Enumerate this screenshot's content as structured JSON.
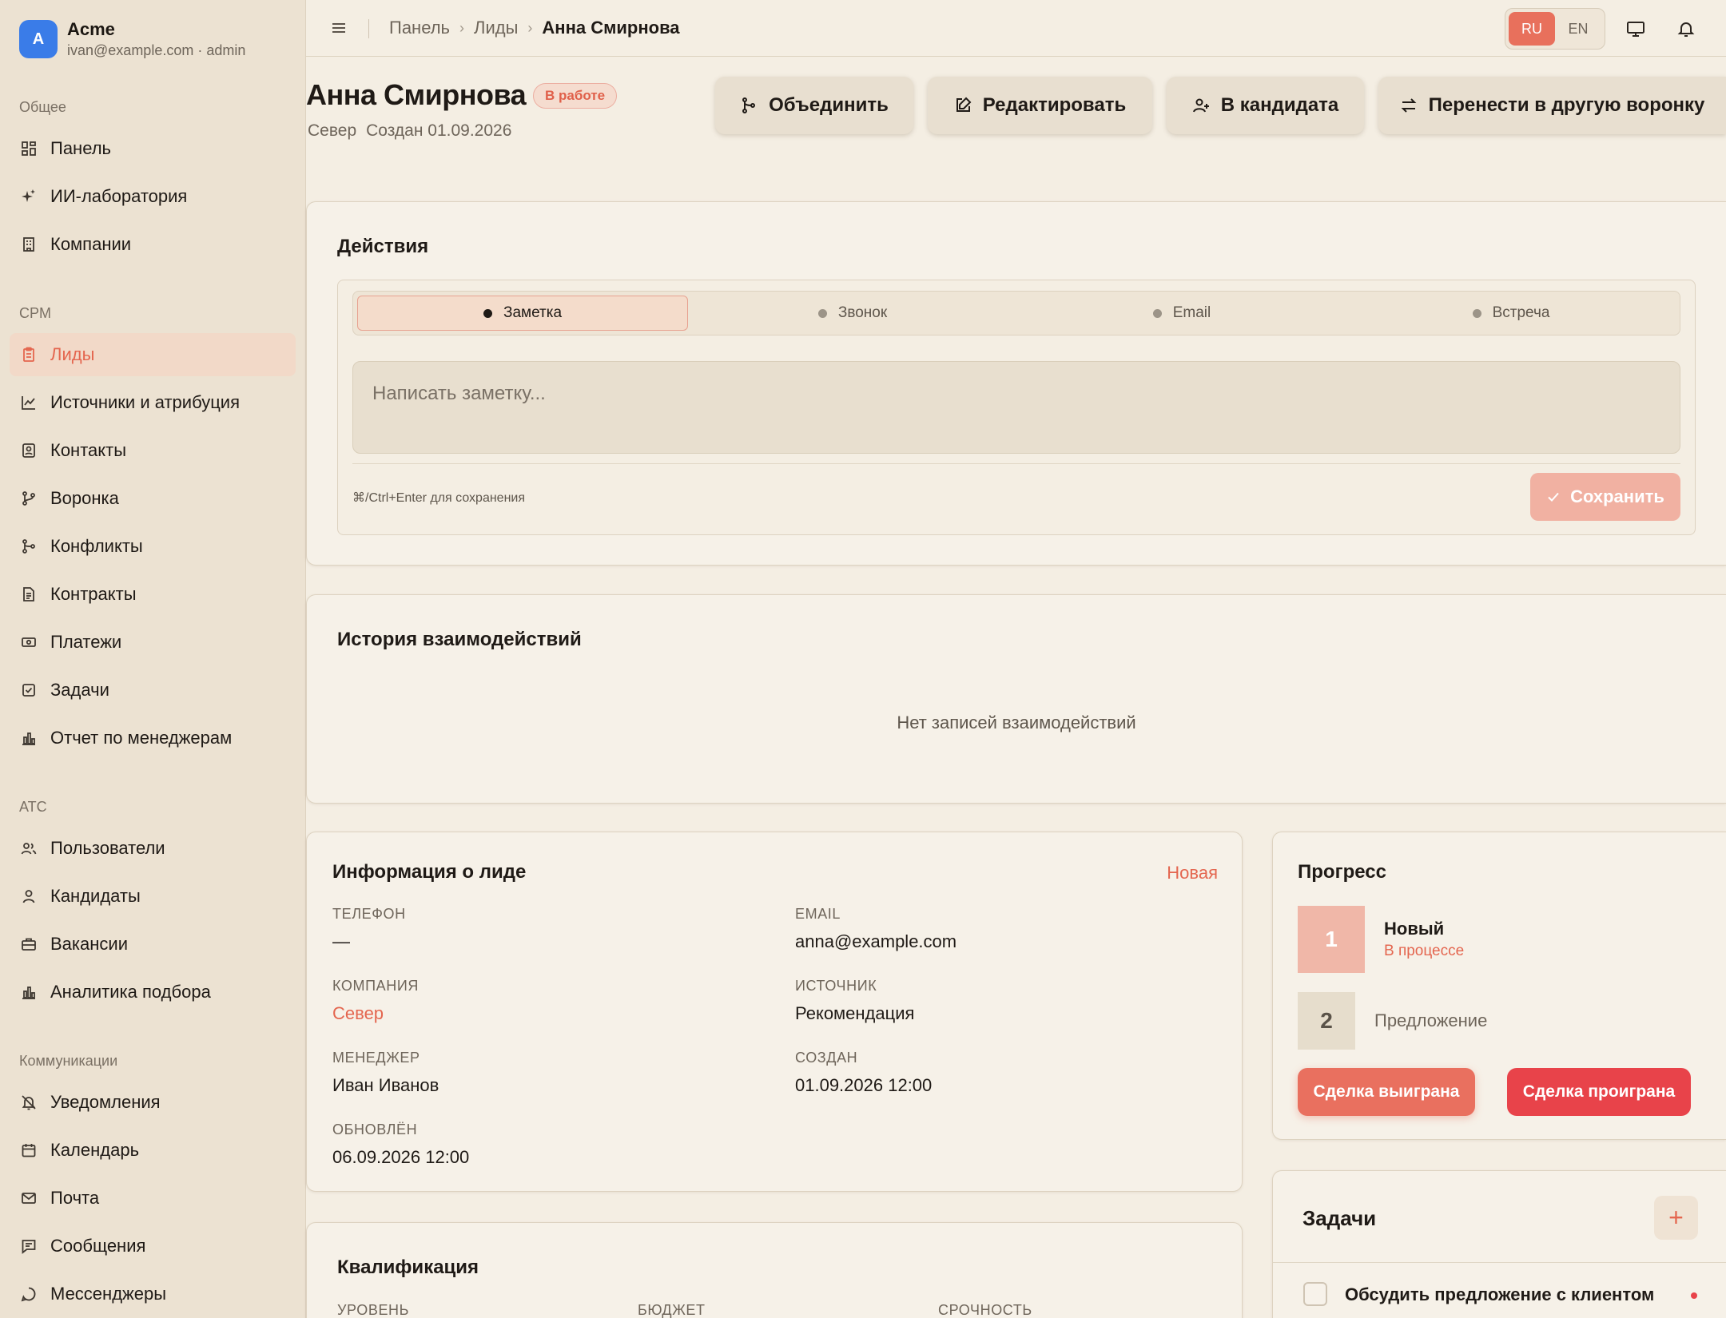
{
  "brand": {
    "logo_letter": "A",
    "name": "Acme",
    "sub": "ivan@example.com · admin",
    "color": "#3a7ce8"
  },
  "sidebar": {
    "sections": [
      {
        "label": "Общее"
      },
      {
        "label": "CPM"
      },
      {
        "label": "ATC"
      },
      {
        "label": "Коммуникации"
      }
    ],
    "items": [
      {
        "label": "Панель",
        "icon": "dashboard-icon"
      },
      {
        "label": "ИИ-лаборатория",
        "icon": "sparkles-icon"
      },
      {
        "label": "Компании",
        "icon": "building-icon"
      },
      {
        "label": "Лиды",
        "icon": "clipboard-icon",
        "active": true
      },
      {
        "label": "Источники и атрибуция",
        "icon": "line-chart-icon"
      },
      {
        "label": "Контакты",
        "icon": "contact-card-icon"
      },
      {
        "label": "Воронка",
        "icon": "branch-icon"
      },
      {
        "label": "Конфликты",
        "icon": "merge-icon"
      },
      {
        "label": "Контракты",
        "icon": "file-text-icon"
      },
      {
        "label": "Платежи",
        "icon": "banknote-icon"
      },
      {
        "label": "Задачи",
        "icon": "checkbox-icon"
      },
      {
        "label": "Отчет по менеджерам",
        "icon": "bar-chart-icon"
      },
      {
        "label": "Пользователи",
        "icon": "users-icon"
      },
      {
        "label": "Кандидаты",
        "icon": "user-icon"
      },
      {
        "label": "Вакансии",
        "icon": "briefcase-icon"
      },
      {
        "label": "Аналитика подбора",
        "icon": "bar-chart-icon"
      },
      {
        "label": "Уведомления",
        "icon": "bell-off-icon"
      },
      {
        "label": "Календарь",
        "icon": "calendar-icon"
      },
      {
        "label": "Почта",
        "icon": "mail-icon"
      },
      {
        "label": "Сообщения",
        "icon": "message-square-icon"
      },
      {
        "label": "Мессенджеры",
        "icon": "message-circle-icon"
      }
    ]
  },
  "topbar": {
    "breadcrumb": [
      "Панель",
      "Лиды",
      "Анна Смирнова"
    ],
    "lang": [
      "RU",
      "EN"
    ],
    "active_lang": "RU"
  },
  "header": {
    "title": "Анна Смирнова",
    "status": "В работе",
    "company": "Север",
    "created": "Создан 01.09.2026",
    "buttons": [
      {
        "label": "Объединить",
        "icon": "merge-icon"
      },
      {
        "label": "Редактировать",
        "icon": "edit-icon"
      },
      {
        "label": "В кандидата",
        "icon": "user-plus-icon"
      },
      {
        "label": "Перенести в другую воронку",
        "icon": "swap-icon"
      }
    ]
  },
  "actions": {
    "title": "Действия",
    "tabs": [
      "Заметка",
      "Звонок",
      "Email",
      "Встреча"
    ],
    "active_tab": "Заметка",
    "note_placeholder": "Написать заметку...",
    "hint": "⌘/Ctrl+Enter для сохранения",
    "save_label": "Сохранить"
  },
  "history": {
    "title": "История взаимодействий",
    "empty": "Нет записей взаимодействий"
  },
  "lead_info": {
    "title": "Информация о лиде",
    "status_link": "Новая",
    "fields": [
      {
        "label": "ТЕЛЕФОН",
        "value": "—"
      },
      {
        "label": "EMAIL",
        "value": "anna@example.com"
      },
      {
        "label": "КОМПАНИЯ",
        "value": "Север"
      },
      {
        "label": "ИСТОЧНИК",
        "value": "Рекомендация"
      },
      {
        "label": "МЕНЕДЖЕР",
        "value": "Иван Иванов"
      },
      {
        "label": "СОЗДАН",
        "value": "01.09.2026 12:00"
      },
      {
        "label": "ОБНОВЛЁН",
        "value": "06.09.2026 12:00"
      }
    ]
  },
  "qualification": {
    "title": "Квалификация",
    "labels": [
      "УРОВЕНЬ",
      "БЮДЖЕТ",
      "СРОЧНОСТЬ"
    ]
  },
  "progress": {
    "title": "Прогресс",
    "steps": [
      {
        "num": "1",
        "name": "Новый",
        "state": "В процессе"
      },
      {
        "num": "2",
        "name": "Предложение"
      }
    ],
    "won_label": "Сделка выиграна",
    "lost_label": "Сделка проиграна"
  },
  "tasks": {
    "title": "Задачи",
    "items": [
      {
        "title": "Обсудить предложение с клиентом"
      }
    ]
  },
  "colors": {
    "accent": "#e4664f",
    "danger": "#e8434a",
    "background": "#f4eee3"
  }
}
